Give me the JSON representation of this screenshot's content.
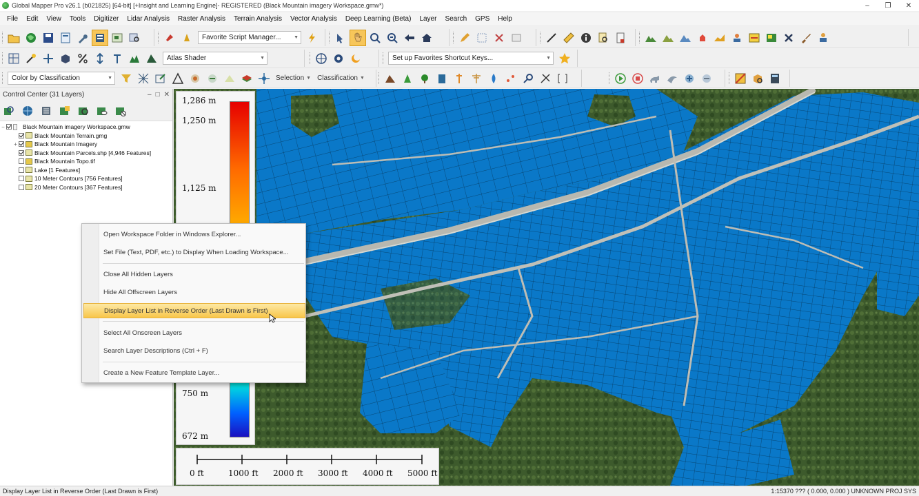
{
  "window": {
    "title": "Global Mapper Pro v26.1 (b021825) [64-bit] [+Insight and Learning Engine]- REGISTERED (Black Mountain imagery Workspace.gmw*)",
    "controls": [
      "–",
      "❐",
      "✕"
    ]
  },
  "menu": [
    "File",
    "Edit",
    "View",
    "Tools",
    "Digitizer",
    "Lidar Analysis",
    "Raster Analysis",
    "Terrain Analysis",
    "Vector Analysis",
    "Deep Learning (Beta)",
    "Layer",
    "Search",
    "GPS",
    "Help"
  ],
  "toolbars": {
    "favorite_script": "Favorite Script Manager...",
    "shader": "Atlas Shader",
    "favorites_shortcut": "Set up Favorites Shortcut Keys...",
    "color_mode": "Color by Classification",
    "selection_label": "Selection",
    "classification_label": "Classification"
  },
  "control_center": {
    "title": "Control Center (31 Layers)",
    "header_buttons": [
      "–",
      "□",
      "✕"
    ],
    "layers": [
      {
        "name": "Black Mountain imagery Workspace.gmw",
        "checked": true,
        "level": 0,
        "expander": "−"
      },
      {
        "name": "Black Mountain Terrain.gmg",
        "checked": true,
        "level": 1,
        "expander": ""
      },
      {
        "name": "Black Mountain Imagery",
        "checked": true,
        "level": 1,
        "expander": "+"
      },
      {
        "name": "Black Mountain Parcels.shp [4,946 Features]",
        "checked": true,
        "level": 1,
        "expander": ""
      },
      {
        "name": "Black Mountain Topo.tif",
        "checked": false,
        "level": 1,
        "expander": ""
      },
      {
        "name": "Lake [1 Features]",
        "checked": false,
        "level": 1,
        "expander": ""
      },
      {
        "name": "10 Meter Contours  [756 Features]",
        "checked": false,
        "level": 1,
        "expander": ""
      },
      {
        "name": "20 Meter Contours [367 Features]",
        "checked": false,
        "level": 1,
        "expander": ""
      }
    ]
  },
  "elevation_legend": {
    "labels": [
      "1,286 m",
      "1,250 m",
      "1,125 m",
      "750 m",
      "672 m"
    ]
  },
  "scale_bar": {
    "labels": [
      "0 ft",
      "1000 ft",
      "2000 ft",
      "3000 ft",
      "4000 ft",
      "5000 ft"
    ]
  },
  "context_menu": {
    "items": [
      "Open Workspace Folder in Windows Explorer...",
      "Set File (Text, PDF, etc.) to Display When Loading Workspace...",
      "Close All Hidden Layers",
      "Hide All Offscreen Layers",
      "Display Layer List in Reverse Order (Last Drawn is First)",
      "Select All Onscreen Layers",
      "Search Layer Descriptions (Ctrl + F)",
      "Create a New Feature Template Layer..."
    ],
    "highlighted_index": 4
  },
  "status": {
    "left": "Display Layer List in Reverse Order (Last Drawn is First)",
    "right": "1:15370  ??? ( 0.000, 0.000 )  UNKNOWN PROJ SYS"
  },
  "colors": {
    "parcels": "#0a78c8",
    "menu_highlight": "#f8c64a",
    "vegetation": "#3f5a2e"
  }
}
